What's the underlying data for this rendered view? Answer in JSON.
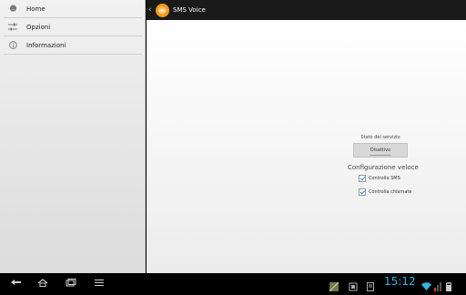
{
  "sidebar": {
    "items": [
      {
        "label": "Home",
        "icon": "chat-bubble-icon"
      },
      {
        "label": "Opzioni",
        "icon": "sliders-icon"
      },
      {
        "label": "Informazioni",
        "icon": "info-icon"
      }
    ]
  },
  "actionbar": {
    "title": "SMS Voice",
    "logo_text": "SMS"
  },
  "main": {
    "service_label": "Stato del servizio",
    "service_button": "Disattivo",
    "quick_config_title": "Configurazione veloce",
    "options": [
      {
        "label": "Controlla SMS",
        "checked": true
      },
      {
        "label": "Controlla chiamate",
        "checked": true
      }
    ]
  },
  "system_bar": {
    "time": "15:12"
  },
  "colors": {
    "accent": "#33b5e5",
    "logo": "#f59a17",
    "checkmark": "#1a8ad3"
  }
}
